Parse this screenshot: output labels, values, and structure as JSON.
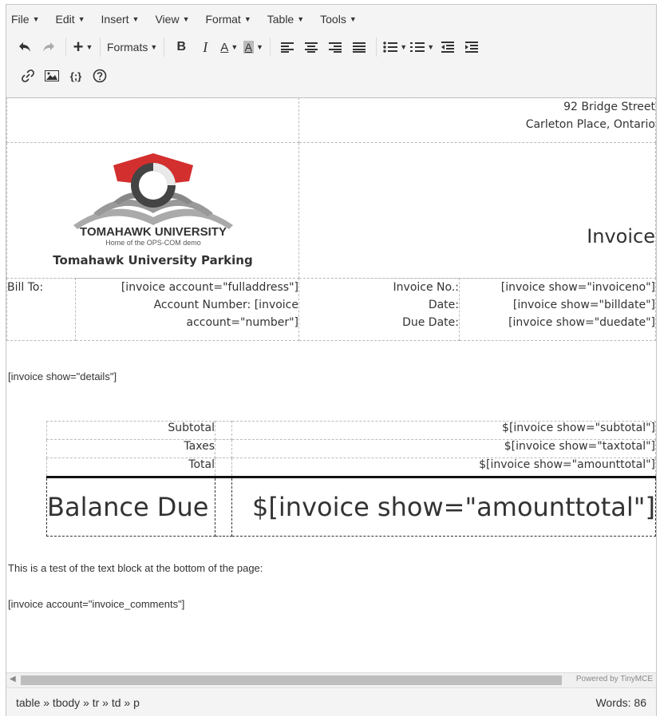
{
  "menubar": {
    "items": [
      "File",
      "Edit",
      "Insert",
      "View",
      "Format",
      "Table",
      "Tools"
    ]
  },
  "toolbar": {
    "formats_label": "Formats",
    "bold": "B",
    "italic": "I",
    "text_color": "A",
    "bg_color": "A",
    "source_code": "{;}"
  },
  "doc": {
    "address_line1": "92 Bridge Street",
    "address_line2": "Carleton Place, Ontario",
    "logo_name": "TOMAHAWK UNIVERSITY",
    "logo_tagline": "Home of the OPS-COM demo",
    "logo_caption": "Tomahawk University Parking",
    "invoice_title": "Invoice",
    "bill_to_label": "Bill To:",
    "bill_to_value1": "[invoice account=\"fulladdress\"]",
    "bill_to_value2": "Account Number: [invoice",
    "bill_to_value3": "account=\"number\"]",
    "invoice_no_label": "Invoice No.:",
    "date_label": "Date:",
    "due_date_label": "Due Date:",
    "invoice_no_value": "[invoice show=\"invoiceno\"]",
    "date_value": "[invoice show=\"billdate\"]",
    "due_date_value": "[invoice show=\"duedate\"]",
    "details": "[invoice show=\"details\"]",
    "subtotal_label": "Subtotal",
    "subtotal_value": "$[invoice show=\"subtotal\"]",
    "taxes_label": "Taxes",
    "taxes_value": "$[invoice show=\"taxtotal\"]",
    "total_label": "Total",
    "total_value": "$[invoice show=\"amounttotal\"]",
    "balance_label": "Balance Due",
    "balance_value": "$[invoice show=\"amounttotal\"]",
    "test_text": "This is a test of the text block at the bottom of the page:",
    "comments": "[invoice account=\"invoice_comments\"]"
  },
  "statusbar": {
    "path": "table » tbody » tr » td » p",
    "words": "Words: 86",
    "powered": "Powered by TinyMCE"
  },
  "colors": {
    "logo_red": "#d32f2f",
    "logo_gray": "#8a8a8a"
  }
}
